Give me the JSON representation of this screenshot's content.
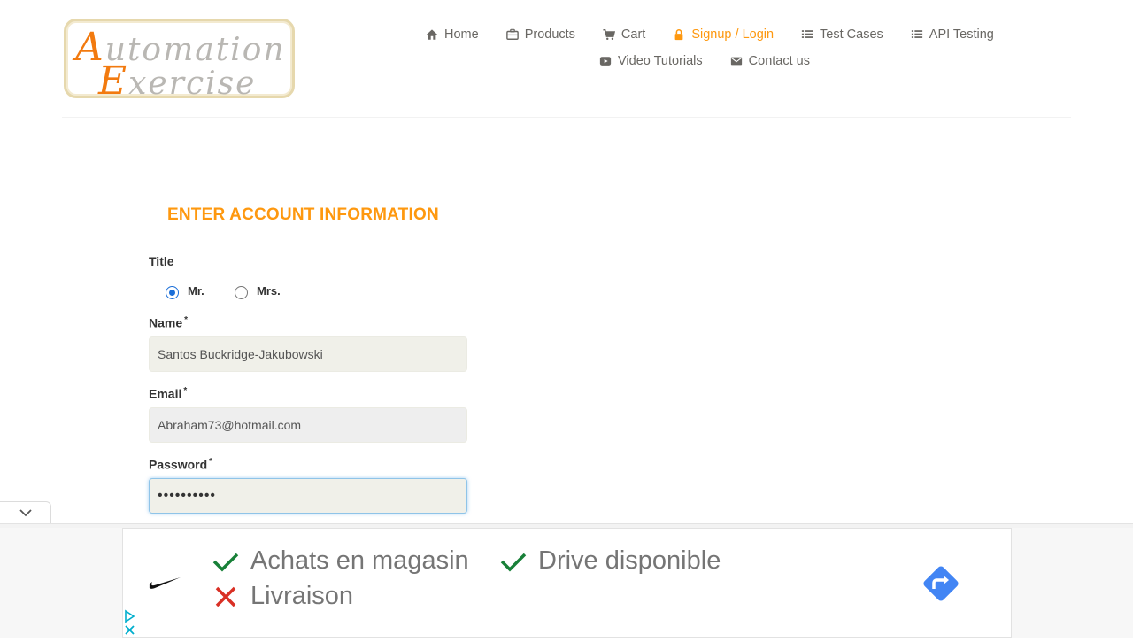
{
  "logo": {
    "line1_cap": "A",
    "line1_rest": "utomation",
    "line2_cap": "E",
    "line2_rest": "xercise"
  },
  "nav": {
    "row1": [
      {
        "label": "Home",
        "icon": "home-icon"
      },
      {
        "label": "Products",
        "icon": "briefcase-icon"
      },
      {
        "label": "Cart",
        "icon": "cart-icon"
      },
      {
        "label": "Signup / Login",
        "icon": "lock-icon",
        "active": true
      },
      {
        "label": "Test Cases",
        "icon": "list-icon"
      },
      {
        "label": "API Testing",
        "icon": "list-icon"
      }
    ],
    "row2": [
      {
        "label": "Video Tutorials",
        "icon": "youtube-play-icon"
      },
      {
        "label": "Contact us",
        "icon": "envelope-icon"
      }
    ]
  },
  "form": {
    "title": "ENTER ACCOUNT INFORMATION",
    "title_label": "Title",
    "radio_mr": "Mr.",
    "radio_mrs": "Mrs.",
    "selected_title": "Mr.",
    "name_label": "Name",
    "name_value": "Santos Buckridge-Jakubowski",
    "email_label": "Email",
    "email_value": "Abraham73@hotmail.com",
    "password_label": "Password",
    "password_value": "••••••••••",
    "required_mark": "*"
  },
  "ad": {
    "item1": "Achats en magasin",
    "item2": "Drive disponible",
    "item3": "Livraison",
    "check_color": "#188038",
    "cross_color": "#d93025",
    "direction_color": "#4285f4"
  },
  "colors": {
    "accent": "#fe980f",
    "text": "#696763"
  }
}
